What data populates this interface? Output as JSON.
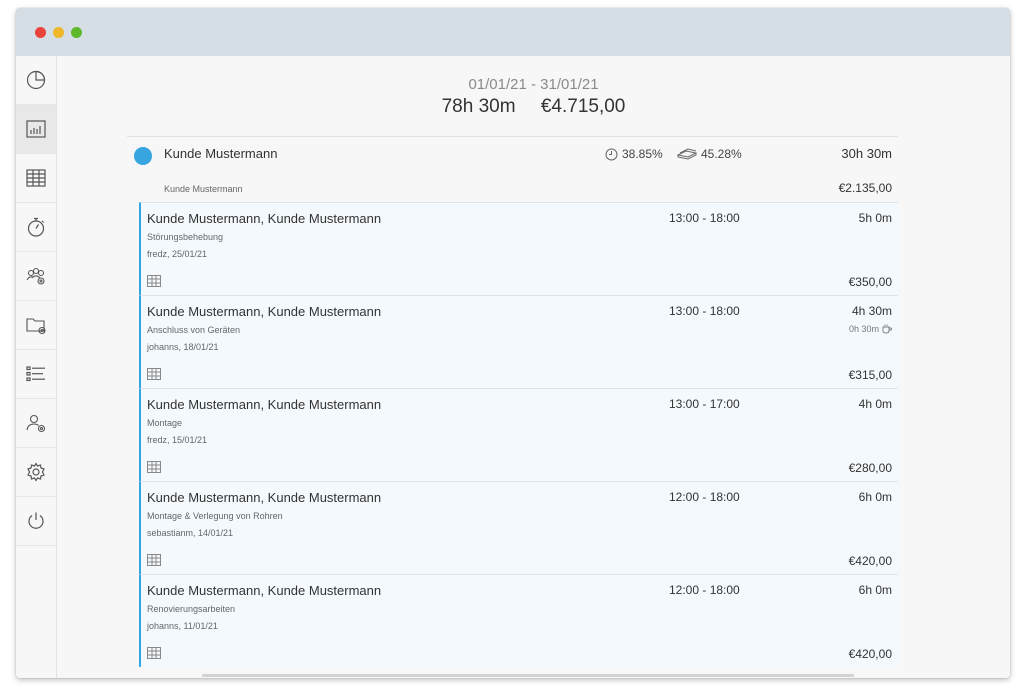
{
  "window": {
    "controls": [
      "close",
      "minimize",
      "maximize"
    ]
  },
  "sidebar": {
    "items": [
      {
        "icon": "pie-chart-icon",
        "active": false
      },
      {
        "icon": "bar-chart-icon",
        "active": true
      },
      {
        "icon": "calendar-grid-icon",
        "active": false
      },
      {
        "icon": "stopwatch-icon",
        "active": false
      },
      {
        "icon": "team-settings-icon",
        "active": false
      },
      {
        "icon": "folder-settings-icon",
        "active": false
      },
      {
        "icon": "list-icon",
        "active": false
      },
      {
        "icon": "user-settings-icon",
        "active": false
      },
      {
        "icon": "gear-icon",
        "active": false
      },
      {
        "icon": "power-icon",
        "active": false
      }
    ]
  },
  "report": {
    "period": "01/01/21 - 31/01/21",
    "total_time": "78h 30m",
    "total_amount": "€4.715,00"
  },
  "customer": {
    "name": "Kunde Mustermann",
    "sub_label": "Kunde Mustermann",
    "time_percent": "38.85%",
    "money_percent": "45.28%",
    "duration": "30h 30m",
    "amount": "€2.135,00",
    "color": "#37a5e0"
  },
  "entries": [
    {
      "title": "Kunde Mustermann, Kunde Mustermann",
      "description": "Störungsbehebung",
      "user_date": "fredz, 25/01/21",
      "time_range": "13:00 - 18:00",
      "duration": "5h 0m",
      "break": "",
      "amount": "€350,00"
    },
    {
      "title": "Kunde Mustermann, Kunde Mustermann",
      "description": "Anschluss von Geräten",
      "user_date": "johanns, 18/01/21",
      "time_range": "13:00 - 18:00",
      "duration": "4h 30m",
      "break": "0h 30m",
      "amount": "€315,00"
    },
    {
      "title": "Kunde Mustermann, Kunde Mustermann",
      "description": "Montage",
      "user_date": "fredz, 15/01/21",
      "time_range": "13:00 - 17:00",
      "duration": "4h 0m",
      "break": "",
      "amount": "€280,00"
    },
    {
      "title": "Kunde Mustermann, Kunde Mustermann",
      "description": "Montage & Verlegung von Rohren",
      "user_date": "sebastianm, 14/01/21",
      "time_range": "12:00 - 18:00",
      "duration": "6h 0m",
      "break": "",
      "amount": "€420,00"
    },
    {
      "title": "Kunde Mustermann, Kunde Mustermann",
      "description": "Renovierungsarbeiten",
      "user_date": "johanns, 11/01/21",
      "time_range": "12:00 - 18:00",
      "duration": "6h 0m",
      "break": "",
      "amount": "€420,00"
    }
  ]
}
